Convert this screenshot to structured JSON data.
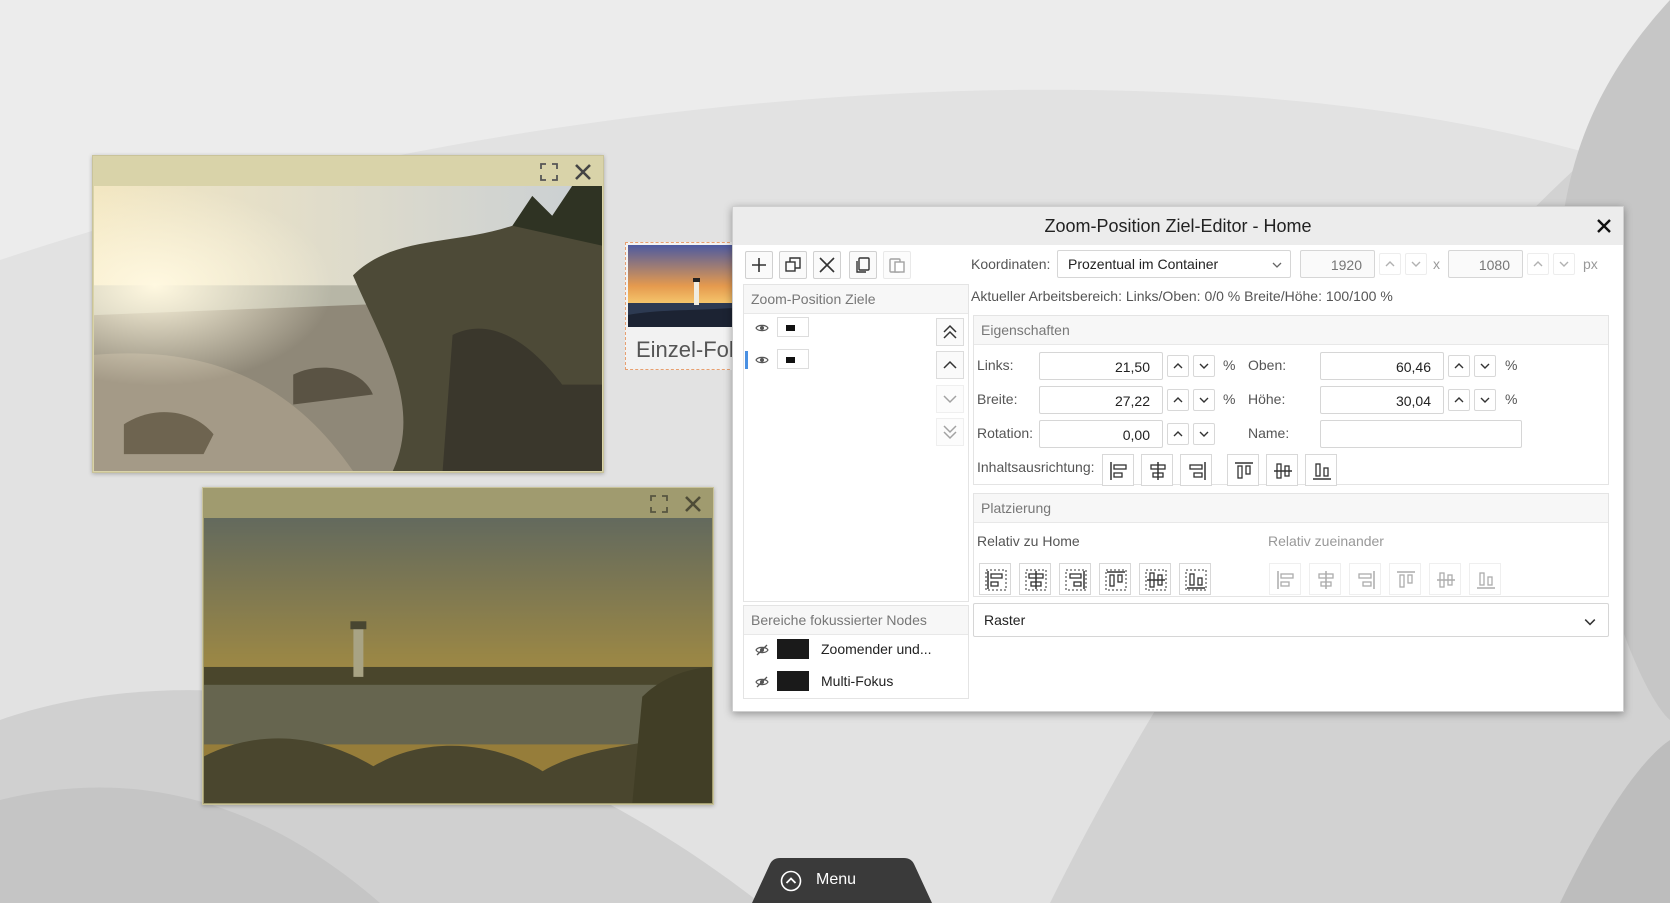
{
  "dialog": {
    "title": "Zoom-Position Ziel-Editor - Home",
    "coordinates_label": "Koordinaten:",
    "coordinates_mode": "Prozentual im Container",
    "res_width": "1920",
    "res_x": "x",
    "res_height": "1080",
    "res_unit": "px",
    "workspace_text": "Aktueller Arbeitsbereich: Links/Oben: 0/0 % Breite/Höhe: 100/100 %"
  },
  "targets": {
    "header": "Zoom-Position Ziele"
  },
  "focused": {
    "header": "Bereiche fokussierter Nodes",
    "items": [
      {
        "label": "Zoomender und..."
      },
      {
        "label": "Multi-Fokus"
      }
    ]
  },
  "properties": {
    "header": "Eigenschaften",
    "links_label": "Links:",
    "links_value": "21,50",
    "oben_label": "Oben:",
    "oben_value": "60,46",
    "breite_label": "Breite:",
    "breite_value": "27,22",
    "hoehe_label": "Höhe:",
    "hoehe_value": "30,04",
    "rotation_label": "Rotation:",
    "rotation_value": "0,00",
    "name_label": "Name:",
    "name_value": "",
    "percent": "%",
    "alignment_label": "Inhaltsausrichtung:"
  },
  "placement": {
    "header": "Platzierung",
    "relative_home": "Relativ zu Home",
    "relative_each": "Relativ zueinander"
  },
  "raster": {
    "label": "Raster"
  },
  "preview": {
    "label": "Einzel-Fokus"
  },
  "menu": {
    "label": "Menu"
  },
  "colors": {
    "accent": "#4a90e2",
    "card_bar": "#d9d3a9",
    "menu_bg": "#3a3a3a"
  }
}
